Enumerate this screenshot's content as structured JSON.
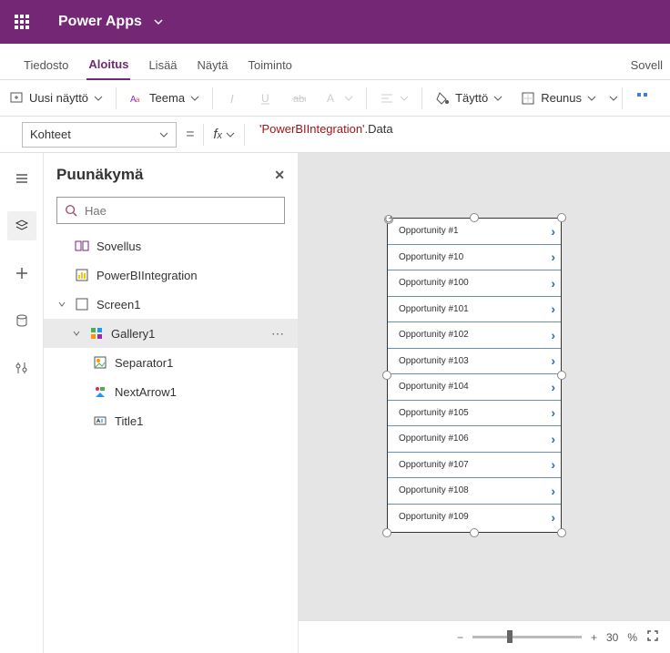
{
  "header": {
    "app_title": "Power Apps"
  },
  "tabs": {
    "items": [
      "Tiedosto",
      "Aloitus",
      "Lisää",
      "Näytä",
      "Toiminto"
    ],
    "active_index": 1,
    "right_label": "Sovell"
  },
  "toolbar": {
    "new_screen": "Uusi näyttö",
    "theme": "Teema",
    "fill": "Täyttö",
    "border": "Reunus"
  },
  "formula": {
    "property": "Kohteet",
    "value_quoted": "'PowerBIIntegration'",
    "value_rest": ".Data"
  },
  "tree": {
    "panel_title": "Puunäkymä",
    "search_placeholder": "Hae",
    "nodes": {
      "app": "Sovellus",
      "pbi": "PowerBIIntegration",
      "screen": "Screen1",
      "gallery": "Gallery1",
      "separator": "Separator1",
      "nextarrow": "NextArrow1",
      "title": "Title1"
    }
  },
  "gallery_items": [
    "Opportunity #1",
    "Opportunity #10",
    "Opportunity #100",
    "Opportunity #101",
    "Opportunity #102",
    "Opportunity #103",
    "Opportunity #104",
    "Opportunity #105",
    "Opportunity #106",
    "Opportunity #107",
    "Opportunity #108",
    "Opportunity #109"
  ],
  "zoom": {
    "percent": "30",
    "unit": "%"
  }
}
